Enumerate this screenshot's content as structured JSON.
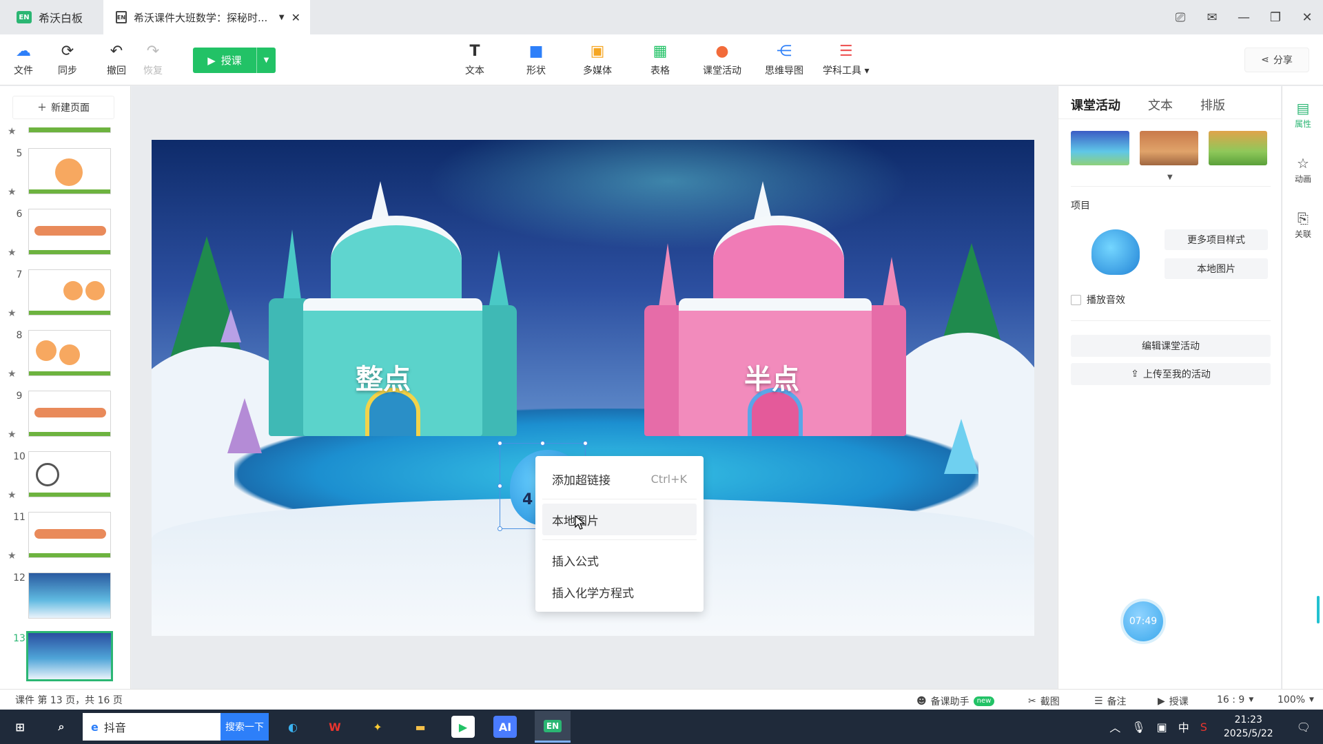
{
  "titlebar": {
    "app_name": "希沃白板",
    "doc_title": "希沃课件大班数学：探秘时...",
    "doc_icon": "EN"
  },
  "toolbar": {
    "file": "文件",
    "sync": "同步",
    "undo": "撤回",
    "redo": "恢复",
    "teach": "授课",
    "text": "文本",
    "shape": "形状",
    "media": "多媒体",
    "table": "表格",
    "activity": "课堂活动",
    "mindmap": "思维导图",
    "subject_tools": "学科工具",
    "share": "分享"
  },
  "left_panel": {
    "new_page": "新建页面",
    "slides": [
      {
        "num": "5"
      },
      {
        "num": "6"
      },
      {
        "num": "7"
      },
      {
        "num": "8"
      },
      {
        "num": "9"
      },
      {
        "num": "10"
      },
      {
        "num": "11"
      },
      {
        "num": "12"
      },
      {
        "num": "13"
      }
    ]
  },
  "canvas": {
    "left_castle_label": "整点",
    "right_castle_label": "半点",
    "monster_number": "4"
  },
  "context_menu": {
    "items": [
      {
        "label": "添加超链接",
        "shortcut": "Ctrl+K"
      },
      {
        "label": "本地图片",
        "shortcut": ""
      },
      {
        "label": "插入公式",
        "shortcut": ""
      },
      {
        "label": "插入化学方程式",
        "shortcut": ""
      }
    ]
  },
  "right_panel": {
    "tabs": [
      "课堂活动",
      "文本",
      "排版"
    ],
    "project_label": "项目",
    "more_styles": "更多项目样式",
    "local_image": "本地图片",
    "play_sound": "播放音效",
    "edit_activity": "编辑课堂活动",
    "upload_activity": "上传至我的活动",
    "timer": "07:49"
  },
  "rail": {
    "props": "属性",
    "anim": "动画",
    "link": "关联"
  },
  "statusbar": {
    "page_info": "课件 第 13 页，共 16 页",
    "assistant": "备课助手",
    "new_badge": "new",
    "crop": "截图",
    "notes": "备注",
    "teach": "授课",
    "ratio": "16 : 9",
    "zoom": "100%"
  },
  "taskbar": {
    "search_text": "抖音",
    "search_button": "搜索一下",
    "ime": "中",
    "time": "21:23",
    "date": "2025/5/22"
  },
  "colors": {
    "accent": "#22c266",
    "selection": "#4a90e2"
  }
}
